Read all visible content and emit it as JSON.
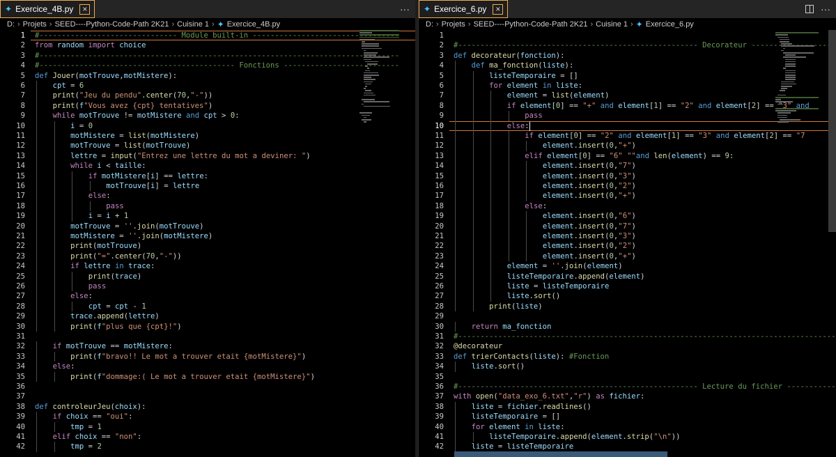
{
  "left": {
    "tab": {
      "label": "Exercice_4B.py",
      "close": "×"
    },
    "breadcrumb": [
      "D:",
      "Projets",
      "SEED----Python-Code-Path 2K21",
      "Cuisine 1",
      "Exercice_4B.py"
    ],
    "more": "···",
    "cursor_line": 1,
    "lines": [
      "#------------------------------- Module built-in ---------------------------------",
      "from random import choice",
      "#---------------------------------------------------------------------------------",
      "#-------------------------------------------- Fonctions --------------------------",
      "def Jouer(motTrouve,motMistere):",
      "    cpt = 6",
      "    print(\"Jeu du pendu\".center(70,\"-\"))",
      "    print(f\"Vous avez {cpt} tentatives\")",
      "    while motTrouve != motMistere and cpt > 0:",
      "        i = 0",
      "        motMistere = list(motMistere)",
      "        motTrouve = list(motTrouve)",
      "        lettre = input(\"Entrez une lettre du mot a deviner: \")",
      "        while i < taille:",
      "            if motMistere[i] == lettre:",
      "                motTrouve[i] = lettre",
      "            else:",
      "                pass",
      "            i = i + 1",
      "        motTrouve = ''.join(motTrouve)",
      "        motMistere = ''.join(motMistere)",
      "        print(motTrouve)",
      "        print(\"=\".center(70,\"-\"))",
      "        if lettre in trace:",
      "            print(trace)",
      "            pass",
      "        else:",
      "            cpt = cpt - 1",
      "        trace.append(lettre)",
      "        print(f\"plus que {cpt}!\")",
      "",
      "    if motTrouve == motMistere:",
      "        print(f\"bravo!! Le mot a trouver etait {motMistere}\")",
      "    else:",
      "        print(f\"dommage:( Le mot a trouver etait {motMistere}\")",
      "",
      "",
      "def controleurJeu(choix):",
      "    if choix == \"oui\":",
      "        tmp = 1",
      "    elif choix == \"non\":",
      "        tmp = 2"
    ]
  },
  "right": {
    "tab": {
      "label": "Exercice_6.py",
      "close": "×"
    },
    "breadcrumb": [
      "D:",
      "Projets",
      "SEED----Python-Code-Path 2K21",
      "Cuisine 1",
      "Exercice_6.py"
    ],
    "more": "···",
    "cursor_line": 10,
    "lines": [
      "",
      "#------------------------------------------------------ Decorateur ---------------------",
      "def decorateur(fonction):",
      "    def ma_fonction(liste):",
      "        listeTemporaire = []",
      "        for element in liste:",
      "            element = list(element)",
      "            if element[0] == \"+\" and element[1] == \"2\" and element[2] == \"3\" and",
      "                pass",
      "            else:",
      "                if element[0] == \"2\" and element[1] == \"3\" and element[2] == \"7",
      "                    element.insert(0,\"+\")",
      "                elif element[0] == \"6\" \"\"and len(element) == 9:",
      "                    element.insert(0,\"7\")",
      "                    element.insert(0,\"3\")",
      "                    element.insert(0,\"2\")",
      "                    element.insert(0,\"+\")",
      "                else:",
      "                    element.insert(0,\"6\")",
      "                    element.insert(0,\"7\")",
      "                    element.insert(0,\"3\")",
      "                    element.insert(0,\"2\")",
      "                    element.insert(0,\"+\")",
      "            element = ''.join(element)",
      "            listeTemporaire.append(element)",
      "            liste = listeTemporaire",
      "            liste.sort()",
      "        print(liste)",
      "",
      "    return ma_fonction",
      "#---------------------------------------------------------------------------------------",
      "@decorateur",
      "def trierContacts(liste): #Fonction",
      "    liste.sort()",
      "",
      "#------------------------------------------------------ Lecture du fichier -------------",
      "with open(\"data_exo_6.txt\",\"r\") as fichier:",
      "    liste = fichier.readlines()",
      "    listeTemporaire = []",
      "    for element in liste:",
      "        listeTemporaire.append(element.strip(\"\\n\"))",
      "    liste = listeTemporaire"
    ]
  }
}
